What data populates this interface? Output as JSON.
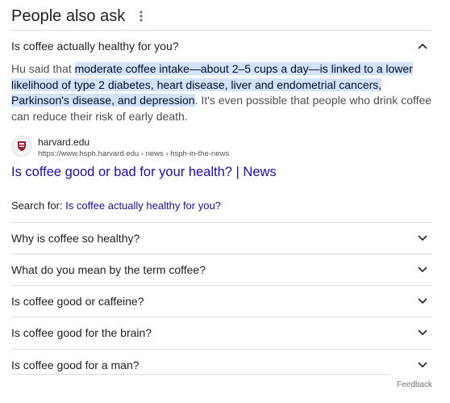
{
  "header": {
    "title": "People also ask",
    "more_icon": "more-vert-icon"
  },
  "expanded": {
    "question": "Is coffee actually healthy for you?",
    "answer_prefix": "Hu said that ",
    "answer_highlight": "moderate coffee intake—about 2–5 cups a day—is linked to a lower likelihood of type 2 diabetes, heart disease, liver and endometrial cancers, Parkinson's disease, and depression",
    "answer_suffix": ". It's even possible that people who drink coffee can reduce their risk of early death.",
    "source": {
      "name": "harvard.edu",
      "url": "https://www.hsph.harvard.edu › news › hsph-in-the-news",
      "icon": "harvard-shield-icon"
    },
    "result_title": "Is coffee good or bad for your health? | News",
    "search_for_label": "Search for: ",
    "search_for_query": "Is coffee actually healthy for you?"
  },
  "questions": [
    "Why is coffee so healthy?",
    "What do you mean by the term coffee?",
    "Is coffee good or caffeine?",
    "Is coffee good for the brain?",
    "Is coffee good for a man?"
  ],
  "feedback": "Feedback",
  "colors": {
    "link": "#1a0dab",
    "highlight": "#d3e3fd",
    "text": "#202124",
    "divider": "#dadce0"
  }
}
